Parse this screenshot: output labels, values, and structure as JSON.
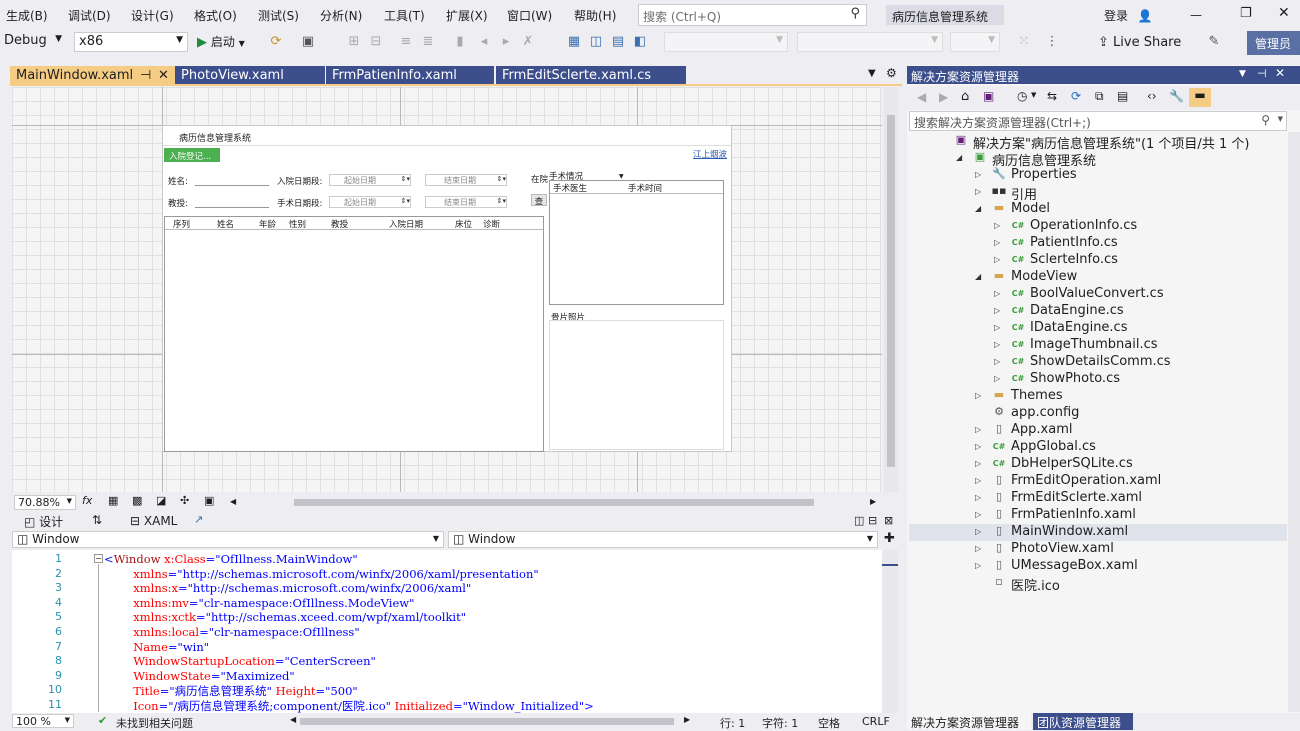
{
  "menu": [
    "生成(B)",
    "调试(D)",
    "设计(G)",
    "格式(O)",
    "测试(S)",
    "分析(N)",
    "工具(T)",
    "扩展(X)",
    "窗口(W)",
    "帮助(H)"
  ],
  "search": {
    "placeholder": "搜索 (Ctrl+Q)"
  },
  "app_title": "病历信息管理系统",
  "account": {
    "login": "登录"
  },
  "toolbar": {
    "config": "Debug",
    "platform": "x86",
    "start": "启动",
    "live_share": "Live Share",
    "admin": "管理员"
  },
  "doc_tabs": [
    "MainWindow.xaml",
    "PhotoView.xaml",
    "FrmPatienInfo.xaml",
    "FrmEditSclerte.xaml.cs"
  ],
  "designer": {
    "window_title": "病历信息管理系统",
    "admit_button": "入院登记...",
    "help_link": "江上烟波",
    "name_label": "姓名:",
    "admit_date_label": "入院日期段:",
    "start_date": "起始日期",
    "end_date": "结束日期",
    "hospital_label": "在院",
    "surgery_status": "手术情况",
    "doctor_label": "教授:",
    "surgery_date_label": "手术日期段:",
    "query": "查",
    "patient_cols": [
      "序列",
      "姓名",
      "年龄",
      "性别",
      "教授",
      "入院日期",
      "床位",
      "诊断"
    ],
    "op_cols": [
      "手术医生",
      "手术时间"
    ],
    "photo_label": "骨片照片"
  },
  "zoom": "70.88%",
  "view_tabs": {
    "design": "设计",
    "swap": "⇅",
    "xaml": "XAML"
  },
  "xaml_nav": {
    "left": "Window",
    "right": "Window"
  },
  "code_lines": [
    [
      {
        "c": "t-pl",
        "t": "<"
      },
      {
        "c": "t-tag",
        "t": "Window"
      },
      {
        "c": "t-attr",
        "t": " x:Class"
      },
      {
        "c": "t-pl",
        "t": "=\""
      },
      {
        "c": "t-val",
        "t": "OfIllness.MainWindow"
      },
      {
        "c": "t-pl",
        "t": "\""
      }
    ],
    [
      {
        "c": "t-attr",
        "t": "        xmlns"
      },
      {
        "c": "t-pl",
        "t": "=\""
      },
      {
        "c": "t-val",
        "t": "http://schemas.microsoft.com/winfx/2006/xaml/presentation"
      },
      {
        "c": "t-pl",
        "t": "\""
      }
    ],
    [
      {
        "c": "t-attr",
        "t": "        xmlns:x"
      },
      {
        "c": "t-pl",
        "t": "=\""
      },
      {
        "c": "t-val",
        "t": "http://schemas.microsoft.com/winfx/2006/xaml"
      },
      {
        "c": "t-pl",
        "t": "\""
      }
    ],
    [
      {
        "c": "t-attr",
        "t": "        xmlns:mv"
      },
      {
        "c": "t-pl",
        "t": "=\""
      },
      {
        "c": "t-val",
        "t": "clr-namespace:OfIllness.ModeView"
      },
      {
        "c": "t-pl",
        "t": "\""
      }
    ],
    [
      {
        "c": "t-attr",
        "t": "        xmlns:xctk"
      },
      {
        "c": "t-pl",
        "t": "=\""
      },
      {
        "c": "t-val",
        "t": "http://schemas.xceed.com/wpf/xaml/toolkit"
      },
      {
        "c": "t-pl",
        "t": "\""
      }
    ],
    [
      {
        "c": "t-attr",
        "t": "        xmlns:local"
      },
      {
        "c": "t-pl",
        "t": "=\""
      },
      {
        "c": "t-val",
        "t": "clr-namespace:OfIllness"
      },
      {
        "c": "t-pl",
        "t": "\""
      }
    ],
    [
      {
        "c": "t-attr",
        "t": "        Name"
      },
      {
        "c": "t-pl",
        "t": "=\""
      },
      {
        "c": "t-val",
        "t": "win"
      },
      {
        "c": "t-pl",
        "t": "\""
      }
    ],
    [
      {
        "c": "t-attr",
        "t": "        WindowStartupLocation"
      },
      {
        "c": "t-pl",
        "t": "=\""
      },
      {
        "c": "t-val",
        "t": "CenterScreen"
      },
      {
        "c": "t-pl",
        "t": "\""
      }
    ],
    [
      {
        "c": "t-attr",
        "t": "        WindowState"
      },
      {
        "c": "t-pl",
        "t": "=\""
      },
      {
        "c": "t-val",
        "t": "Maximized"
      },
      {
        "c": "t-pl",
        "t": "\""
      }
    ],
    [
      {
        "c": "t-attr",
        "t": "        Title"
      },
      {
        "c": "t-pl",
        "t": "=\""
      },
      {
        "c": "t-val",
        "t": "病历信息管理系统"
      },
      {
        "c": "t-pl",
        "t": "\""
      },
      {
        "c": "t-attr",
        "t": " Height"
      },
      {
        "c": "t-pl",
        "t": "=\""
      },
      {
        "c": "t-val",
        "t": "500"
      },
      {
        "c": "t-pl",
        "t": "\""
      }
    ],
    [
      {
        "c": "t-attr",
        "t": "        Icon"
      },
      {
        "c": "t-pl",
        "t": "=\""
      },
      {
        "c": "t-val",
        "t": "/病历信息管理系统;component/医院.ico"
      },
      {
        "c": "t-pl",
        "t": "\""
      },
      {
        "c": "t-attr",
        "t": " Initialized"
      },
      {
        "c": "t-pl",
        "t": "=\""
      },
      {
        "c": "t-val",
        "t": "Window_Initialized"
      },
      {
        "c": "t-pl",
        "t": "\">"
      }
    ]
  ],
  "status": {
    "zoom": "100 %",
    "issues": "未找到相关问题",
    "line": "行: 1",
    "char": "字符: 1",
    "space": "空格",
    "eol": "CRLF"
  },
  "solution_explorer": {
    "title": "解决方案资源管理器",
    "search": "搜索解决方案资源管理器(Ctrl+;)",
    "tree": [
      {
        "label": "解决方案\"病历信息管理系统\"(1 个项目/共 1 个)",
        "depth": 0,
        "icon": "solution",
        "expand": "none"
      },
      {
        "label": "病历信息管理系统",
        "depth": 1,
        "icon": "project",
        "expand": "open"
      },
      {
        "label": "Properties",
        "depth": 2,
        "icon": "wrench",
        "expand": "closed"
      },
      {
        "label": "引用",
        "depth": 2,
        "icon": "ref",
        "expand": "closed"
      },
      {
        "label": "Model",
        "depth": 2,
        "icon": "folder",
        "expand": "open"
      },
      {
        "label": "OperationInfo.cs",
        "depth": 3,
        "icon": "cs",
        "expand": "closed"
      },
      {
        "label": "PatientInfo.cs",
        "depth": 3,
        "icon": "cs",
        "expand": "closed"
      },
      {
        "label": "SclerteInfo.cs",
        "depth": 3,
        "icon": "cs",
        "expand": "closed"
      },
      {
        "label": "ModeView",
        "depth": 2,
        "icon": "folder",
        "expand": "open"
      },
      {
        "label": "BoolValueConvert.cs",
        "depth": 3,
        "icon": "cs",
        "expand": "closed"
      },
      {
        "label": "DataEngine.cs",
        "depth": 3,
        "icon": "cs",
        "expand": "closed"
      },
      {
        "label": "IDataEngine.cs",
        "depth": 3,
        "icon": "cs",
        "expand": "closed"
      },
      {
        "label": "ImageThumbnail.cs",
        "depth": 3,
        "icon": "cs",
        "expand": "closed"
      },
      {
        "label": "ShowDetailsComm.cs",
        "depth": 3,
        "icon": "cs",
        "expand": "closed"
      },
      {
        "label": "ShowPhoto.cs",
        "depth": 3,
        "icon": "cs",
        "expand": "closed"
      },
      {
        "label": "Themes",
        "depth": 2,
        "icon": "folder",
        "expand": "closed"
      },
      {
        "label": "app.config",
        "depth": 2,
        "icon": "config",
        "expand": "none"
      },
      {
        "label": "App.xaml",
        "depth": 2,
        "icon": "xaml",
        "expand": "closed"
      },
      {
        "label": "AppGlobal.cs",
        "depth": 2,
        "icon": "cs",
        "expand": "closed"
      },
      {
        "label": "DbHelperSQLite.cs",
        "depth": 2,
        "icon": "cs",
        "expand": "closed"
      },
      {
        "label": "FrmEditOperation.xaml",
        "depth": 2,
        "icon": "xaml",
        "expand": "closed"
      },
      {
        "label": "FrmEditSclerte.xaml",
        "depth": 2,
        "icon": "xaml",
        "expand": "closed"
      },
      {
        "label": "FrmPatienInfo.xaml",
        "depth": 2,
        "icon": "xaml",
        "expand": "closed"
      },
      {
        "label": "MainWindow.xaml",
        "depth": 2,
        "icon": "xaml",
        "expand": "closed",
        "selected": true
      },
      {
        "label": "PhotoView.xaml",
        "depth": 2,
        "icon": "xaml",
        "expand": "closed"
      },
      {
        "label": "UMessageBox.xaml",
        "depth": 2,
        "icon": "xaml",
        "expand": "closed"
      },
      {
        "label": "医院.ico",
        "depth": 2,
        "icon": "ico",
        "expand": "none"
      }
    ],
    "bottom_tabs": [
      "解决方案资源管理器",
      "团队资源管理器"
    ]
  }
}
